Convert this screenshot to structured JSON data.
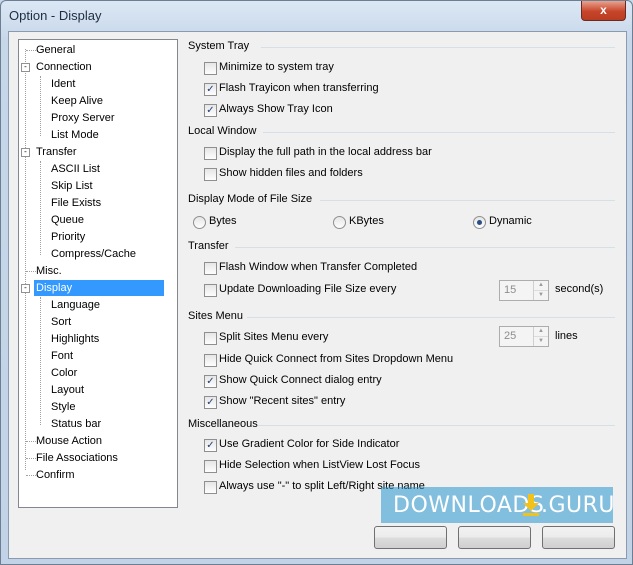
{
  "window": {
    "title": "Option - Display",
    "close_glyph": "x"
  },
  "tree": {
    "items": [
      {
        "label": "General",
        "level": 0
      },
      {
        "label": "Connection",
        "level": 0,
        "expander": "-"
      },
      {
        "label": "Ident",
        "level": 1
      },
      {
        "label": "Keep Alive",
        "level": 1
      },
      {
        "label": "Proxy Server",
        "level": 1
      },
      {
        "label": "List Mode",
        "level": 1
      },
      {
        "label": "Transfer",
        "level": 0,
        "expander": "-"
      },
      {
        "label": "ASCII List",
        "level": 1
      },
      {
        "label": "Skip List",
        "level": 1
      },
      {
        "label": "File Exists",
        "level": 1
      },
      {
        "label": "Queue",
        "level": 1
      },
      {
        "label": "Priority",
        "level": 1
      },
      {
        "label": "Compress/Cache",
        "level": 1
      },
      {
        "label": "Misc.",
        "level": 0
      },
      {
        "label": "Display",
        "level": 0,
        "expander": "-",
        "selected": true
      },
      {
        "label": "Language",
        "level": 1
      },
      {
        "label": "Sort",
        "level": 1
      },
      {
        "label": "Highlights",
        "level": 1
      },
      {
        "label": "Font",
        "level": 1
      },
      {
        "label": "Color",
        "level": 1
      },
      {
        "label": "Layout",
        "level": 1
      },
      {
        "label": "Style",
        "level": 1
      },
      {
        "label": "Status bar",
        "level": 1
      },
      {
        "label": "Mouse Action",
        "level": 0
      },
      {
        "label": "File Associations",
        "level": 0
      },
      {
        "label": "Confirm",
        "level": 0
      }
    ]
  },
  "groups": {
    "system_tray": {
      "title": "System Tray",
      "options": [
        {
          "label": "Minimize to system tray",
          "checked": false
        },
        {
          "label": "Flash Trayicon when transferring",
          "checked": true
        },
        {
          "label": "Always Show Tray Icon",
          "checked": true
        }
      ]
    },
    "local_window": {
      "title": "Local Window",
      "options": [
        {
          "label": "Display the full path in the local address bar",
          "checked": false
        },
        {
          "label": "Show hidden files and folders",
          "checked": false
        }
      ]
    },
    "display_mode": {
      "title": "Display Mode of File Size",
      "radios": [
        {
          "label": "Bytes",
          "selected": false
        },
        {
          "label": "KBytes",
          "selected": false
        },
        {
          "label": "Dynamic",
          "selected": true
        }
      ]
    },
    "transfer": {
      "title": "Transfer",
      "options": [
        {
          "label": "Flash Window when Transfer Completed",
          "checked": false
        },
        {
          "label": "Update Downloading File Size every",
          "checked": false
        }
      ],
      "spin_value": "15",
      "spin_unit": "second(s)"
    },
    "sites_menu": {
      "title": "Sites Menu",
      "options": [
        {
          "label": "Split Sites Menu every",
          "checked": false
        },
        {
          "label": "Hide Quick Connect from Sites Dropdown Menu",
          "checked": false
        },
        {
          "label": "Show Quick Connect dialog entry",
          "checked": true
        },
        {
          "label": "Show \"Recent sites\" entry",
          "checked": true
        }
      ],
      "spin_value": "25",
      "spin_unit": "lines"
    },
    "misc": {
      "title": "Miscellaneous",
      "options": [
        {
          "label": "Use Gradient Color for Side Indicator",
          "checked": true
        },
        {
          "label": "Hide Selection when ListView Lost Focus",
          "checked": false
        },
        {
          "label": "Always use \"-\" to split Left/Right site name",
          "checked": false
        }
      ]
    }
  },
  "watermark": {
    "left": "DOWNLOADS",
    "right": ".GURU"
  },
  "check_glyph": "✓",
  "spin_up": "▲",
  "spin_down": "▼"
}
